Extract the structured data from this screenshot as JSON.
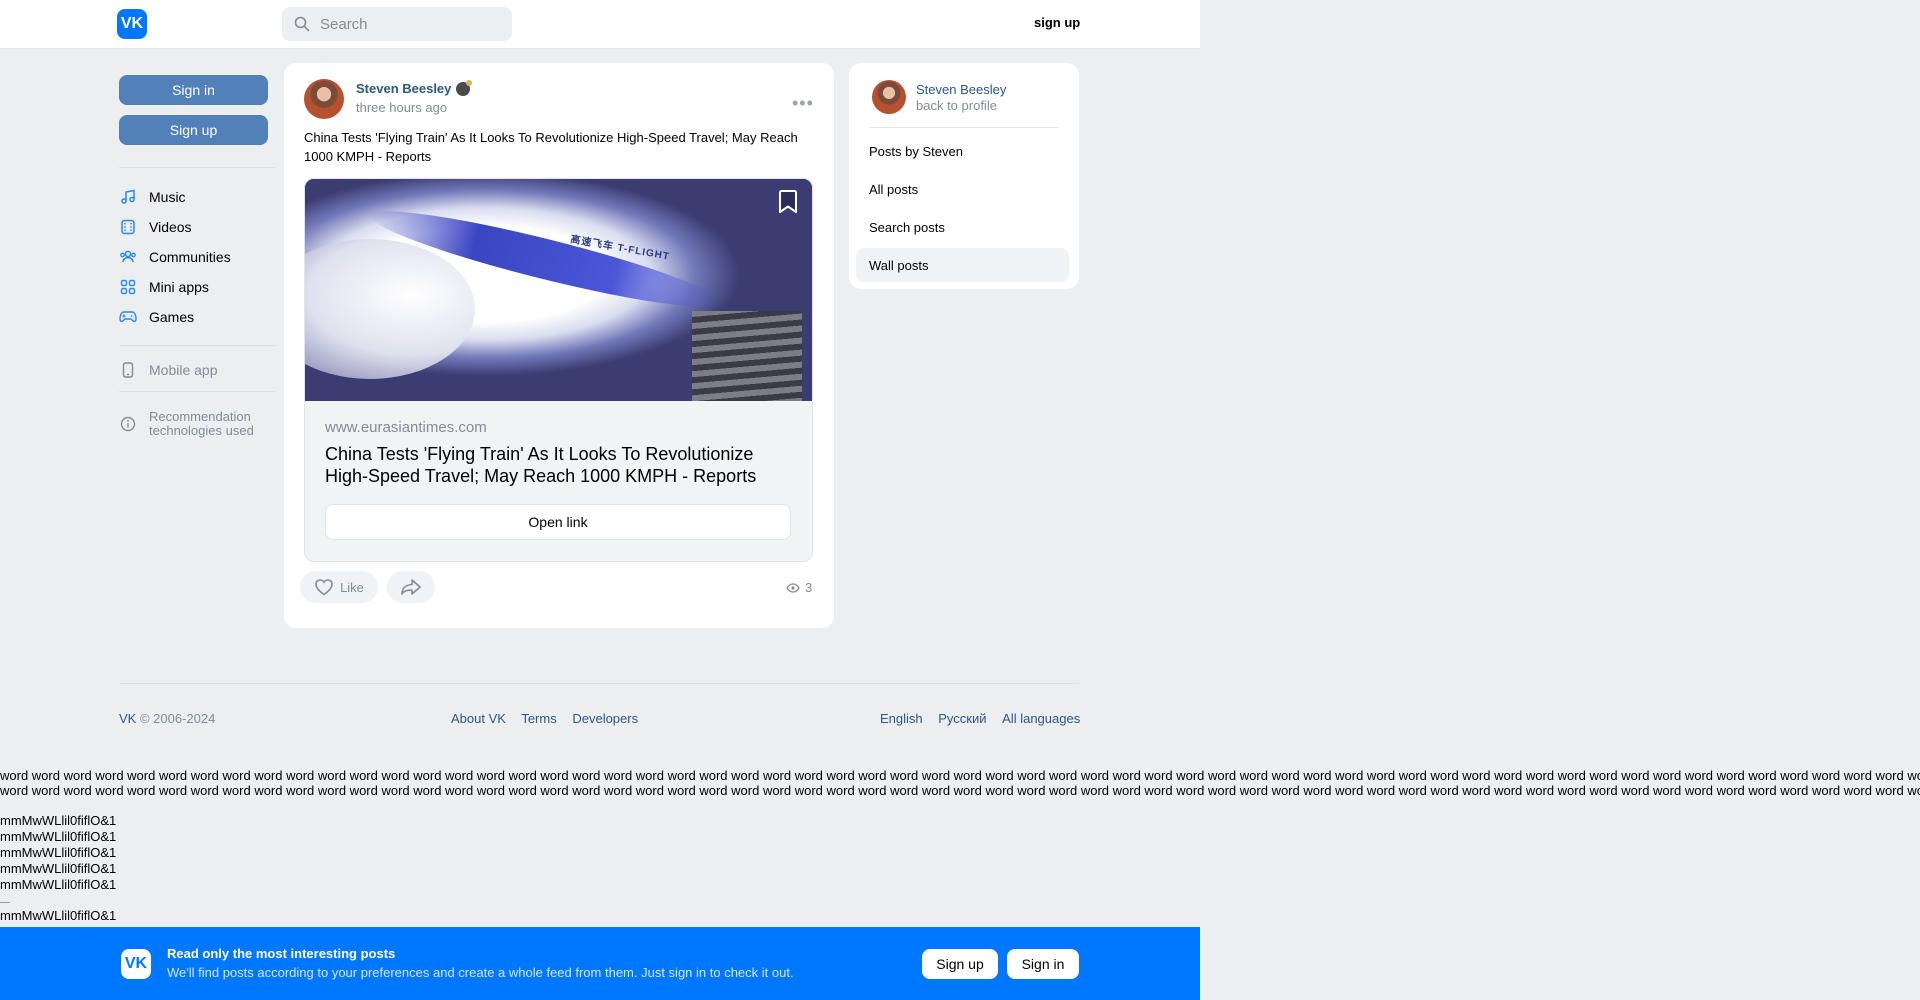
{
  "header": {
    "logo_text": "VK",
    "search_placeholder": "Search",
    "signup_label": "sign up"
  },
  "sidebar": {
    "signin_label": "Sign in",
    "signup_label": "Sign up",
    "items": [
      {
        "label": "Music",
        "icon": "music-icon"
      },
      {
        "label": "Videos",
        "icon": "video-icon"
      },
      {
        "label": "Communities",
        "icon": "communities-icon"
      },
      {
        "label": "Mini apps",
        "icon": "mini-apps-icon"
      },
      {
        "label": "Games",
        "icon": "gamepad-icon"
      }
    ],
    "mobile_app": "Mobile app",
    "recommendation_line1": "Recommendation",
    "recommendation_line2": "technologies used"
  },
  "post": {
    "author": "Steven Beesley",
    "time": "three hours ago",
    "text": "China Tests 'Flying Train' As It Looks To Revolutionize High-Speed Travel; May Reach 1000 KMPH - Reports",
    "image_caption": "高速飞车 T-FLIGHT",
    "link_domain": "www.eurasiantimes.com",
    "link_title": "China Tests 'Flying Train' As It Looks To Revolutionize High-Speed Travel; May Reach 1000 KMPH - Reports",
    "open_link_label": "Open link",
    "like_label": "Like",
    "views": "3"
  },
  "profile_card": {
    "name": "Steven Beesley",
    "back_label": "back to profile",
    "menu": [
      {
        "label": "Posts by Steven"
      },
      {
        "label": "All posts"
      },
      {
        "label": "Search posts"
      },
      {
        "label": "Wall posts",
        "active": true
      }
    ]
  },
  "footer": {
    "vk": "VK",
    "copyright": " © 2006-2024",
    "links": [
      "About VK",
      "Terms",
      "Developers"
    ],
    "languages": [
      "English",
      "Русский",
      "All languages"
    ]
  },
  "filler": {
    "words_line1": "word word word word word word word word word word word word word word word word word word word word word word word word word word word word word word word word word word word word word word word word word word word word word word word word word word word word word word word word word word word word word word word word word word word",
    "words_line2": "word word word word word word word word word word word word word word word word word word word word word word word word word word word word word word word word word word word word word word word word word word word word word word word word word word word word word word word word word word word word word word word word word word word",
    "mm_lines": [
      "mmMwWLlil0fiflO&1",
      "mmMwWLlil0fiflO&1",
      "mmMwWLlil0fiflO&1",
      "mmMwWLlil0fiflO&1",
      "mmMwWLlil0fiflO&1",
      "mmMwWLlil0fiflO&1"
    ]
  },
  "banner": {
    "title": "Read only the most interesting posts",
    "subtitle": "We'll find posts according to your preferences and create a whole feed from them. Just sign in to check it out.",
    "signup_label": "Sign up",
    "signin_label": "Sign in"
  },
  "colors": {
    "brand": "#0077ff",
    "sidebar_button": "#5181b8",
    "link": "#2a5885",
    "background": "#edeef0"
  }
}
